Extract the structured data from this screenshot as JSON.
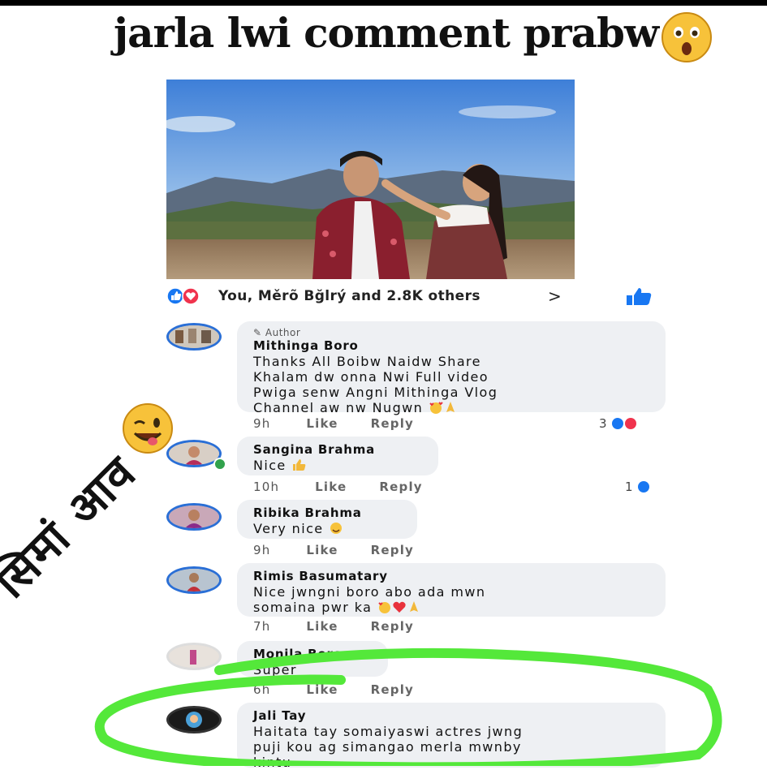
{
  "headline": "jarla lwi comment prabw",
  "post": {
    "reactions_text": "You, Měrõ Bğlrý and 2.8K others",
    "reactions_chevron": ">"
  },
  "hindi_overlay": "सिमां आव",
  "comments": [
    {
      "author_tag": "Author",
      "name": "Mithinga Boro",
      "text": "Thanks All Boibw Naidw Share\nKhalam dw onna Nwi Full video\nPwiga senw Angni Mithinga Vlog\nChannel aw nw Nugwn",
      "time": "9h",
      "like": "Like",
      "reply": "Reply",
      "reactions": "3"
    },
    {
      "name": "Sangina Brahma",
      "text": "Nice",
      "time": "10h",
      "like": "Like",
      "reply": "Reply",
      "reactions": "1"
    },
    {
      "name": "Ribika Brahma",
      "text": "Very nice",
      "time": "9h",
      "like": "Like",
      "reply": "Reply"
    },
    {
      "name": "Rimis Basumatary",
      "text": "Nice jwngni boro abo ada mwn\nsomaina pwr ka",
      "time": "7h",
      "like": "Like",
      "reply": "Reply"
    },
    {
      "name": "Monila Boro",
      "text": "Super",
      "time": "6h",
      "like": "Like",
      "reply": "Reply"
    },
    {
      "name": "Jali Tay",
      "text": "Haitata tay somaiyaswi actres jwng\npuji kou ag simangao merla mwnby\nkintu"
    }
  ],
  "colors": {
    "like_blue": "#1877f2",
    "love_red": "#f0334d",
    "highlight_green": "#54e83a",
    "bubble_bg": "#eef0f3"
  }
}
